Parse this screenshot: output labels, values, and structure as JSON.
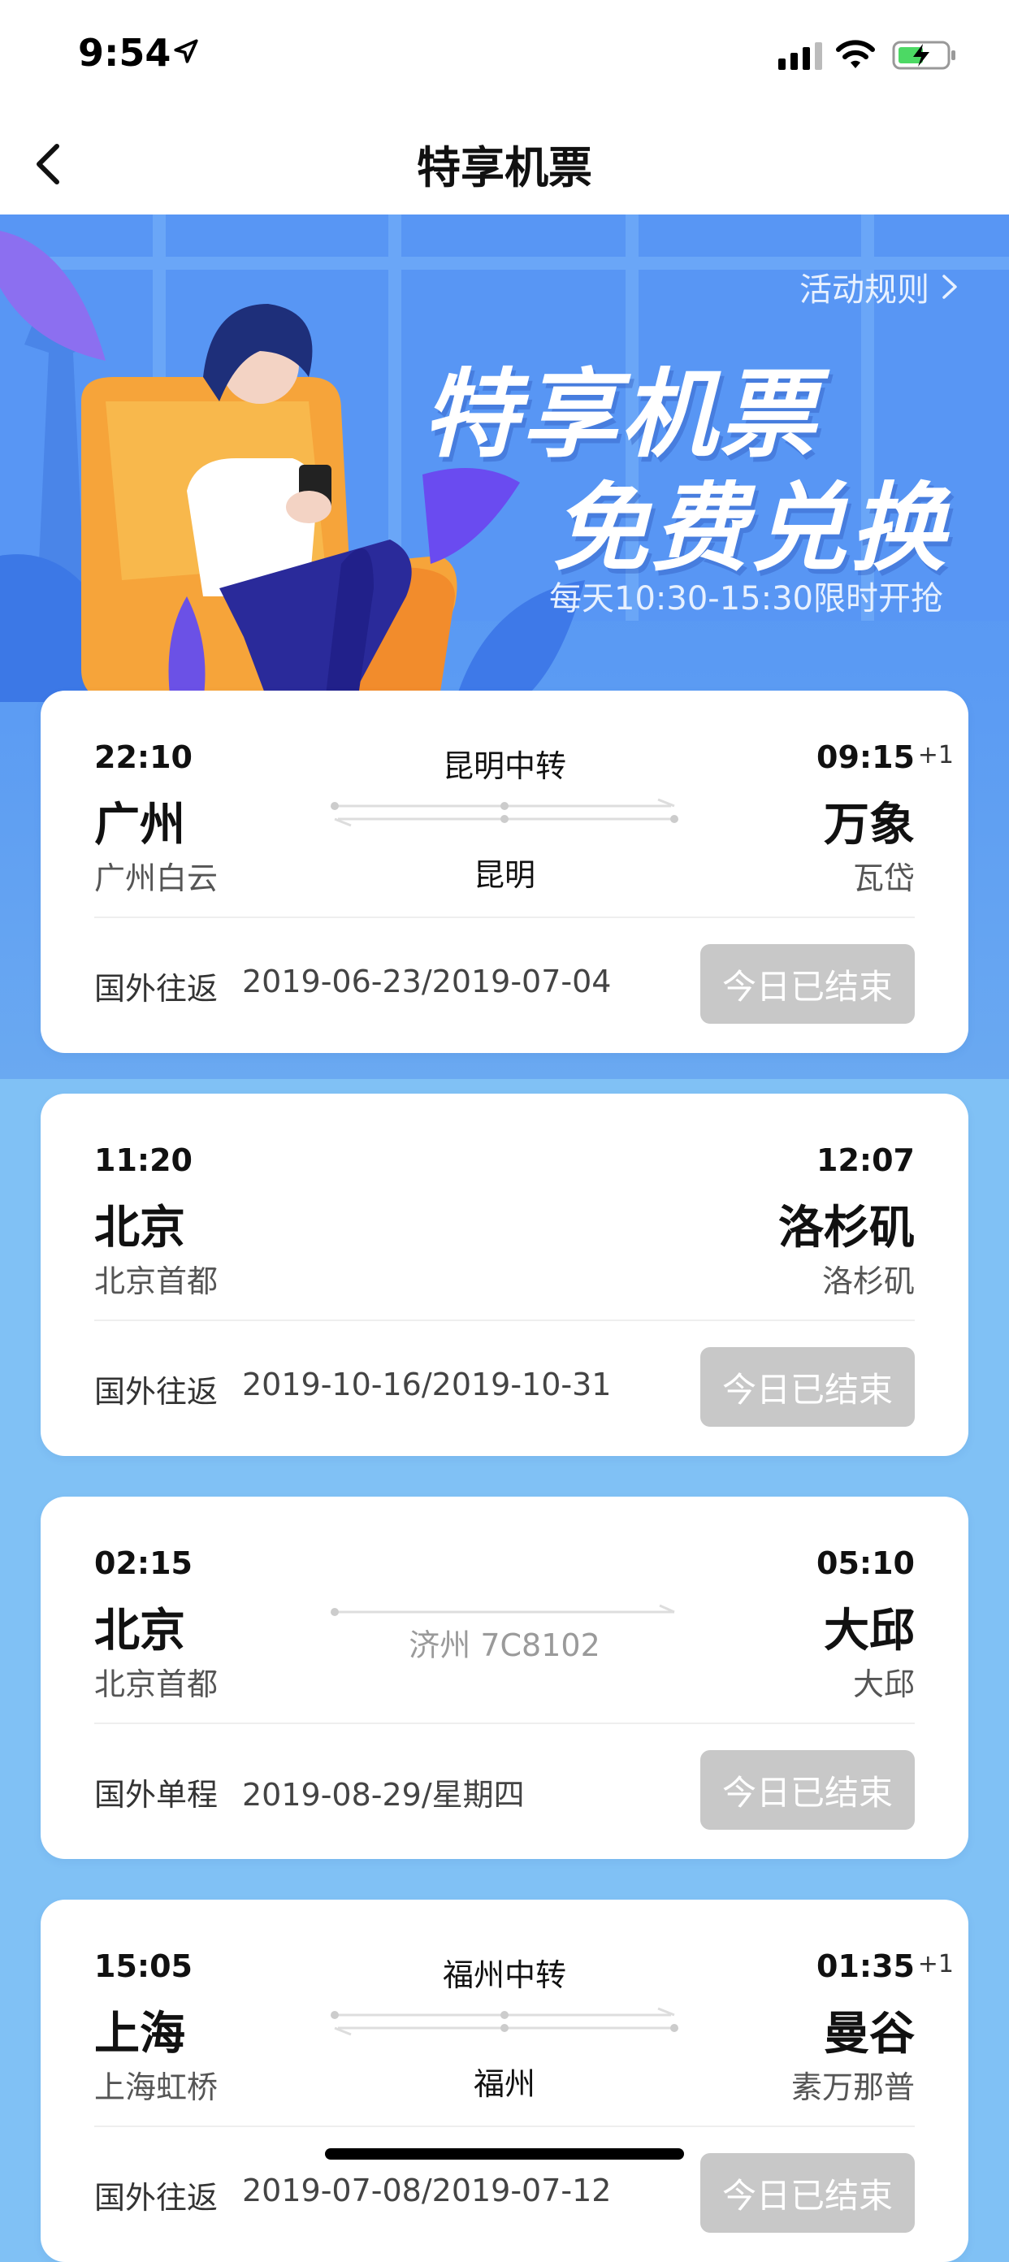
{
  "status_bar": {
    "time": "9:54"
  },
  "nav": {
    "title": "特享机票"
  },
  "banner": {
    "rules_label": "活动规则",
    "title_line1": "特享机票",
    "title_line2": "免费兑换",
    "subtitle": "每天10:30-15:30限时开抢"
  },
  "cards": [
    {
      "dep_time": "22:10",
      "dep_city": "广州",
      "dep_airport": "广州白云",
      "arr_time": "09:15",
      "plus_day": "+1",
      "arr_city": "万象",
      "arr_airport": "瓦岱",
      "transfer": "昆明中转",
      "stop": "昆明",
      "trip_type": "国外往返",
      "dates": "2019-06-23/2019-07-04",
      "status": "今日已结束"
    },
    {
      "dep_time": "11:20",
      "dep_city": "北京",
      "dep_airport": "北京首都",
      "arr_time": "12:07",
      "arr_city": "洛杉矶",
      "arr_airport": "洛杉矶",
      "trip_type": "国外往返",
      "dates": "2019-10-16/2019-10-31",
      "status": "今日已结束"
    },
    {
      "dep_time": "02:15",
      "dep_city": "北京",
      "dep_airport": "北京首都",
      "arr_time": "05:10",
      "arr_city": "大邱",
      "arr_airport": "大邱",
      "flight_no": "济州 7C8102",
      "trip_type": "国外单程",
      "dates": "2019-08-29/星期四",
      "status": "今日已结束"
    },
    {
      "dep_time": "15:05",
      "dep_city": "上海",
      "dep_airport": "上海虹桥",
      "arr_time": "01:35",
      "plus_day": "+1",
      "arr_city": "曼谷",
      "arr_airport": "素万那普",
      "transfer": "福州中转",
      "stop": "福州",
      "trip_type": "国外往返",
      "dates": "2019-07-08/2019-07-12",
      "status": "今日已结束"
    }
  ],
  "colors": {
    "banner_blue": "#4f8ff5",
    "page_blue": "#80c1f5",
    "disabled_button": "#c8c8c8"
  },
  "icons": [
    "location-arrow-icon",
    "signal-icon",
    "wifi-icon",
    "battery-charging-icon",
    "back-chevron-icon",
    "chevron-right-icon"
  ]
}
